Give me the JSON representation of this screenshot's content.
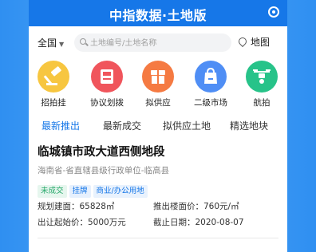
{
  "app": {
    "title": "中指数据·土地版"
  },
  "search": {
    "region": "全国",
    "placeholder": "土地编号/土地名称",
    "map_label": "地图"
  },
  "icons": [
    {
      "label": "招拍挂",
      "icon": "gavel-icon",
      "color": "#f7c640"
    },
    {
      "label": "协议划拨",
      "icon": "book-icon",
      "color": "#f0555c"
    },
    {
      "label": "拟供应",
      "icon": "box-icon",
      "color": "#f57a42"
    },
    {
      "label": "二级市场",
      "icon": "bag-icon",
      "color": "#4f8ef5"
    },
    {
      "label": "航拍",
      "icon": "drone-icon",
      "color": "#27c389"
    }
  ],
  "tabs": [
    {
      "label": "最新推出",
      "active": true
    },
    {
      "label": "最新成交",
      "active": false
    },
    {
      "label": "拟供应土地",
      "active": false
    },
    {
      "label": "精选地块",
      "active": false
    }
  ],
  "listing": {
    "title": "临城镇市政大道西侧地段",
    "location": "海南省-省直辖县级行政单位-临高县",
    "tags": [
      "未成交",
      "挂牌",
      "商业/办公用地"
    ],
    "planned_area_label": "规划建面：",
    "planned_area_value": "65828㎡",
    "floor_price_label": "推出楼面价：",
    "floor_price_value": "760元/㎡",
    "start_price_label": "出让起始价：",
    "start_price_value": "5000万元",
    "deadline_label": "截止日期：",
    "deadline_value": "2020-08-07"
  },
  "colors": {
    "brand": "#1677e8",
    "background": "#2a8ef0"
  }
}
